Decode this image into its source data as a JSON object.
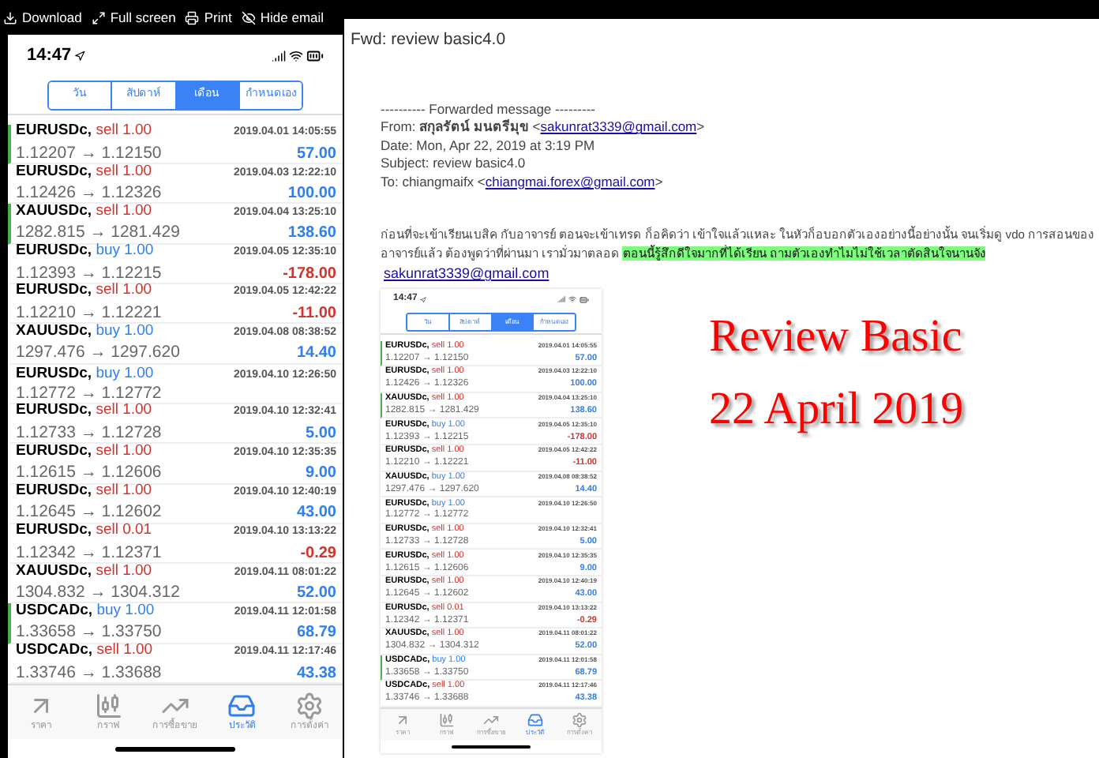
{
  "toolbar": [
    {
      "label": "Download"
    },
    {
      "label": "Full screen"
    },
    {
      "label": "Print"
    },
    {
      "label": "Hide email"
    }
  ],
  "phone": {
    "time": "14:47",
    "segments": [
      {
        "label": "วัน",
        "selected": false
      },
      {
        "label": "สัปดาห์",
        "selected": false
      },
      {
        "label": "เดือน",
        "selected": true
      },
      {
        "label": "กำหนดเอง",
        "selected": false
      }
    ],
    "trades": [
      {
        "symbol": "EURUSDc,",
        "order": "sell 1.00",
        "kind": "sell",
        "time": "2019.04.01 14:05:55",
        "prices": "1.12207 → 1.12150",
        "profit": {
          "text": "57.00",
          "kind": "gain"
        },
        "marked": true
      },
      {
        "symbol": "EURUSDc,",
        "order": "sell 1.00",
        "kind": "sell",
        "time": "2019.04.03 12:22:10",
        "prices": "1.12426 → 1.12326",
        "profit": {
          "text": "100.00",
          "kind": "gain"
        },
        "marked": false
      },
      {
        "symbol": "XAUUSDc,",
        "order": "sell 1.00",
        "kind": "sell",
        "time": "2019.04.04 13:25:10",
        "prices": "1282.815 → 1281.429",
        "profit": {
          "text": "138.60",
          "kind": "gain"
        },
        "marked": true
      },
      {
        "symbol": "EURUSDc,",
        "order": "buy 1.00",
        "kind": "buy",
        "time": "2019.04.05 12:35:10",
        "prices": "1.12393 → 1.12215",
        "profit": {
          "text": "-178.00",
          "kind": "loss"
        },
        "marked": false
      },
      {
        "symbol": "EURUSDc,",
        "order": "sell 1.00",
        "kind": "sell",
        "time": "2019.04.05 12:42:22",
        "prices": "1.12210 → 1.12221",
        "profit": {
          "text": "-11.00",
          "kind": "loss"
        },
        "marked": false
      },
      {
        "symbol": "XAUUSDc,",
        "order": "buy 1.00",
        "kind": "buy",
        "time": "2019.04.08 08:38:52",
        "prices": "1297.476 → 1297.620",
        "profit": {
          "text": "14.40",
          "kind": "gain"
        },
        "marked": false
      },
      {
        "symbol": "EURUSDc,",
        "order": "buy 1.00",
        "kind": "buy",
        "time": "2019.04.10 12:26:50",
        "prices": "1.12772 → 1.12772",
        "marked": false
      },
      {
        "symbol": "EURUSDc,",
        "order": "sell 1.00",
        "kind": "sell",
        "time": "2019.04.10 12:32:41",
        "prices": "1.12733 → 1.12728",
        "profit": {
          "text": "5.00",
          "kind": "gain"
        },
        "marked": false
      },
      {
        "symbol": "EURUSDc,",
        "order": "sell 1.00",
        "kind": "sell",
        "time": "2019.04.10 12:35:35",
        "prices": "1.12615 → 1.12606",
        "profit": {
          "text": "9.00",
          "kind": "gain"
        },
        "marked": false
      },
      {
        "symbol": "EURUSDc,",
        "order": "sell 1.00",
        "kind": "sell",
        "time": "2019.04.10 12:40:19",
        "prices": "1.12645 → 1.12602",
        "profit": {
          "text": "43.00",
          "kind": "gain"
        },
        "marked": false
      },
      {
        "symbol": "EURUSDc,",
        "order": "sell 0.01",
        "kind": "sell",
        "time": "2019.04.10 13:13:22",
        "prices": "1.12342 → 1.12371",
        "profit": {
          "text": "-0.29",
          "kind": "loss"
        },
        "marked": false
      },
      {
        "symbol": "XAUUSDc,",
        "order": "sell 1.00",
        "kind": "sell",
        "time": "2019.04.11 08:01:22",
        "prices": "1304.832 → 1304.312",
        "profit": {
          "text": "52.00",
          "kind": "gain"
        },
        "marked": false
      },
      {
        "symbol": "USDCADc,",
        "order": "buy 1.00",
        "kind": "buy",
        "time": "2019.04.11 12:01:58",
        "prices": "1.33658 → 1.33750",
        "profit": {
          "text": "68.79",
          "kind": "gain"
        },
        "marked": true
      },
      {
        "symbol": "USDCADc,",
        "order": "sell 1.00",
        "kind": "sell",
        "time": "2019.04.11 12:17:46",
        "prices": "1.33746 → 1.33688",
        "profit": {
          "text": "43.38",
          "kind": "gain"
        },
        "marked": false
      }
    ],
    "tabbar": [
      {
        "label": "ราคา",
        "selected": false
      },
      {
        "label": "กราฟ",
        "selected": false
      },
      {
        "label": "การซื้อขาย",
        "selected": false
      },
      {
        "label": "ประวัติ",
        "selected": true
      },
      {
        "label": "การตั้งค่า",
        "selected": false
      }
    ]
  },
  "email": {
    "subject": "Fwd: review basic4.0",
    "header": [
      {
        "text": "---------- Forwarded message ---------"
      },
      {
        "text": "From: **สกุลรัตน์ มนตรีมุข** <",
        "link": "sakunrat3339@gmail.com",
        "after": ">"
      },
      {
        "text": "Date: Mon, Apr 22, 2019 at 3:19 PM"
      },
      {
        "text": "Subject: review basic4.0"
      },
      {
        "text": "To: chiangmaifx <",
        "link": "chiangmai.forex@gmail.com",
        "after": ">"
      }
    ],
    "body": "ก่อนที่จะเข้าเรียนเบสิค กับอาจารย์ ตอนจะเข้าเทรด ก็อคิดว่า เข้าใจแล้วแหละ ในหัวก็อบอกตัวเองอย่างนี้อย่างนั้น จนเริ่มดู vdo การสอนของอาจารย์แล้ว ต้องพูดว่าที่ผ่านมา เรามั่วมาตลอด",
    "highlight": "ตอนนี้รู้สึกดีใจมากที่ได้เรียน ถามตัวเองทำไมไม่ใช้เวลาตัดสินใจนานจัง",
    "signature_link": "sakunrat3339@gmail.com",
    "screenshot": {
      "time": "14:47",
      "segments": [
        {
          "label": "วัน",
          "selected": false
        },
        {
          "label": "สัปดาห์",
          "selected": false
        },
        {
          "label": "เดือน",
          "selected": true
        },
        {
          "label": "กำหนดเอง",
          "selected": false
        }
      ],
      "trades": [
        {
          "symbol": "EURUSDc,",
          "order": "sell 1.00",
          "kind": "sell",
          "time": "2019.04.01 14:05:55",
          "prices": "1.12207 → 1.12150",
          "profit": {
            "text": "57.00",
            "kind": "gain"
          },
          "marked": true
        },
        {
          "symbol": "EURUSDc,",
          "order": "sell 1.00",
          "kind": "sell",
          "time": "2019.04.03 12:22:10",
          "prices": "1.12426 → 1.12326",
          "profit": {
            "text": "100.00",
            "kind": "gain"
          },
          "marked": false
        },
        {
          "symbol": "XAUUSDc,",
          "order": "sell 1.00",
          "kind": "sell",
          "time": "2019.04.04 13:25:10",
          "prices": "1282.815 → 1281.429",
          "profit": {
            "text": "138.60",
            "kind": "gain"
          },
          "marked": true
        },
        {
          "symbol": "EURUSDc,",
          "order": "buy 1.00",
          "kind": "buy",
          "time": "2019.04.05 12:35:10",
          "prices": "1.12393 → 1.12215",
          "profit": {
            "text": "-178.00",
            "kind": "loss"
          },
          "marked": false
        },
        {
          "symbol": "EURUSDc,",
          "order": "sell 1.00",
          "kind": "sell",
          "time": "2019.04.05 12:42:22",
          "prices": "1.12210 → 1.12221",
          "profit": {
            "text": "-11.00",
            "kind": "loss"
          },
          "marked": false
        },
        {
          "symbol": "XAUUSDc,",
          "order": "buy 1.00",
          "kind": "buy",
          "time": "2019.04.08 08:38:52",
          "prices": "1297.476 → 1297.620",
          "profit": {
            "text": "14.40",
            "kind": "gain"
          },
          "marked": false
        },
        {
          "symbol": "EURUSDc,",
          "order": "buy 1.00",
          "kind": "buy",
          "time": "2019.04.10 12:26:50",
          "prices": "1.12772 → 1.12772",
          "marked": false
        },
        {
          "symbol": "EURUSDc,",
          "order": "sell 1.00",
          "kind": "sell",
          "time": "2019.04.10 12:32:41",
          "prices": "1.12733 → 1.12728",
          "profit": {
            "text": "5.00",
            "kind": "gain"
          },
          "marked": false
        },
        {
          "symbol": "EURUSDc,",
          "order": "sell 1.00",
          "kind": "sell",
          "time": "2019.04.10 12:35:35",
          "prices": "1.12615 → 1.12606",
          "profit": {
            "text": "9.00",
            "kind": "gain"
          },
          "marked": false
        },
        {
          "symbol": "EURUSDc,",
          "order": "sell 1.00",
          "kind": "sell",
          "time": "2019.04.10 12:40:19",
          "prices": "1.12645 → 1.12602",
          "profit": {
            "text": "43.00",
            "kind": "gain"
          },
          "marked": false
        },
        {
          "symbol": "EURUSDc,",
          "order": "sell 0.01",
          "kind": "sell",
          "time": "2019.04.10 13:13:22",
          "prices": "1.12342 → 1.12371",
          "profit": {
            "text": "-0.29",
            "kind": "loss"
          },
          "marked": false
        },
        {
          "symbol": "XAUUSDc,",
          "order": "sell 1.00",
          "kind": "sell",
          "time": "2019.04.11 08:01:22",
          "prices": "1304.832 → 1304.312",
          "profit": {
            "text": "52.00",
            "kind": "gain"
          },
          "marked": false
        },
        {
          "symbol": "USDCADc,",
          "order": "buy 1.00",
          "kind": "buy",
          "time": "2019.04.11 12:01:58",
          "prices": "1.33658 → 1.33750",
          "profit": {
            "text": "68.79",
            "kind": "gain"
          },
          "marked": true
        },
        {
          "symbol": "USDCADc,",
          "order": "sell 1.00",
          "kind": "sell",
          "time": "2019.04.11 12:17:46",
          "prices": "1.33746 → 1.33688",
          "profit": {
            "text": "43.38",
            "kind": "gain"
          },
          "marked": false
        }
      ],
      "tabbar": [
        {
          "label": "ราคา",
          "selected": false
        },
        {
          "label": "กราฟ",
          "selected": false
        },
        {
          "label": "การซื้อขาย",
          "selected": false
        },
        {
          "label": "ประวัติ",
          "selected": true
        },
        {
          "label": "การตั้งค่า",
          "selected": false
        }
      ]
    },
    "overlay": [
      "Review Basic",
      "22 April 2019"
    ]
  }
}
